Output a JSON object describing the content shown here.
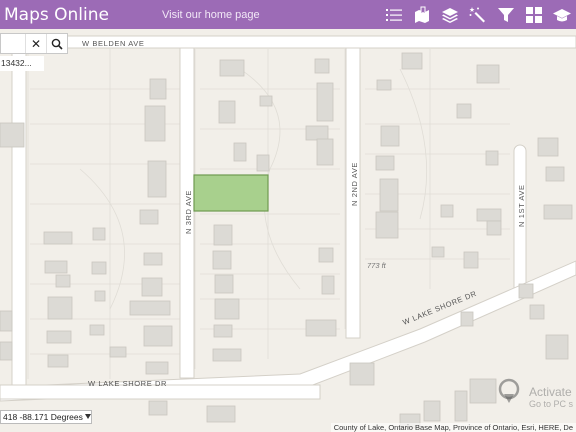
{
  "header": {
    "app_title": "Maps Online",
    "home_link": "Visit our home page",
    "tools": [
      {
        "icon": "layer-list-icon",
        "name": "tool-layer-list"
      },
      {
        "icon": "bookmark-map-icon",
        "name": "tool-bookmarks"
      },
      {
        "icon": "layers-icon",
        "name": "tool-basemap"
      },
      {
        "icon": "magic-select-icon",
        "name": "tool-select"
      },
      {
        "icon": "filter-icon",
        "name": "tool-filter"
      },
      {
        "icon": "grid-icon",
        "name": "tool-apps"
      },
      {
        "icon": "graduation-cap-icon",
        "name": "tool-help"
      }
    ]
  },
  "search": {
    "value": "",
    "clear_glyph": "✕",
    "result_hint": "13432..."
  },
  "map": {
    "roads": {
      "belden": "W BELDEN AVE",
      "third": "N 3RD AVE",
      "second": "N 2ND AVE",
      "first": "N 1ST AVE",
      "lake_shore_upper": "W LAKE SHORE DR",
      "lake_shore_lower": "W LAKE SHORE DR"
    },
    "elevation_label": "773 ft",
    "selected_parcel_color": "#a8d08d"
  },
  "coordinates": "418 -88.171 Degrees",
  "attribution": "County of Lake, Ontario Base Map, Province of Ontario, Esri, HERE, De",
  "watermark": {
    "line1": "Activate",
    "line2": "Go to PC s"
  },
  "colors": {
    "header": "#9c6bb6",
    "map_background": "#f2efe9",
    "building": "#dcdad5"
  }
}
